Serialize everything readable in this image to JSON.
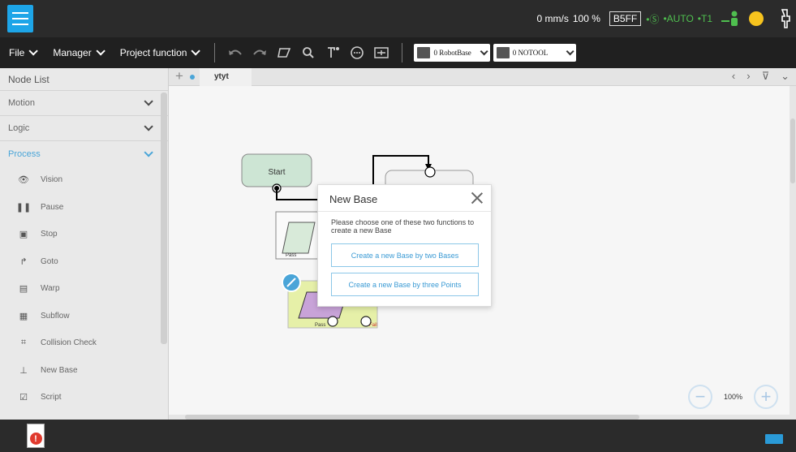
{
  "status": {
    "speed": "0 mm/s",
    "override": "100 %",
    "station": "B5FF",
    "s_mode": "•Ⓢ",
    "mode": "•AUTO",
    "tool_frame": "•T1"
  },
  "menu": {
    "file": "File",
    "manager": "Manager",
    "project_function": "Project function"
  },
  "toolbar": {
    "base_select": "0 RobotBase",
    "tool_select": "0 NOTOOL"
  },
  "node_list": {
    "title": "Node List",
    "categories": [
      {
        "label": "Motion"
      },
      {
        "label": "Logic"
      },
      {
        "label": "Process"
      }
    ],
    "items": [
      {
        "label": "Vision",
        "icon": "eye-icon"
      },
      {
        "label": "Pause",
        "icon": "pause-icon"
      },
      {
        "label": "Stop",
        "icon": "stop-icon"
      },
      {
        "label": "Goto",
        "icon": "goto-arrow-icon"
      },
      {
        "label": "Warp",
        "icon": "warp-icon"
      },
      {
        "label": "Subflow",
        "icon": "subflow-icon"
      },
      {
        "label": "Collision Check",
        "icon": "collision-check-icon"
      },
      {
        "label": "New Base",
        "icon": "new-base-icon"
      },
      {
        "label": "Script",
        "icon": "script-icon"
      }
    ]
  },
  "canvas": {
    "tab_name": "ytyt",
    "zoom": "100%",
    "nodes": {
      "start": "Start",
      "pass1": "Pass",
      "pass2": "Pass",
      "fail": "Fail"
    }
  },
  "dialog": {
    "title": "New Base",
    "message": "Please choose one of these two functions to create a new Base",
    "btn_two_bases": "Create a new Base by two Bases",
    "btn_three_points": "Create a new Base by three Points"
  },
  "colors": {
    "accent": "#1da5e8",
    "topbar": "#2b2b2b",
    "menubar": "#202020",
    "process_blue": "#4aa5d8",
    "alarm_red": "#e03a2e",
    "status_yellow": "#f6c31e"
  }
}
